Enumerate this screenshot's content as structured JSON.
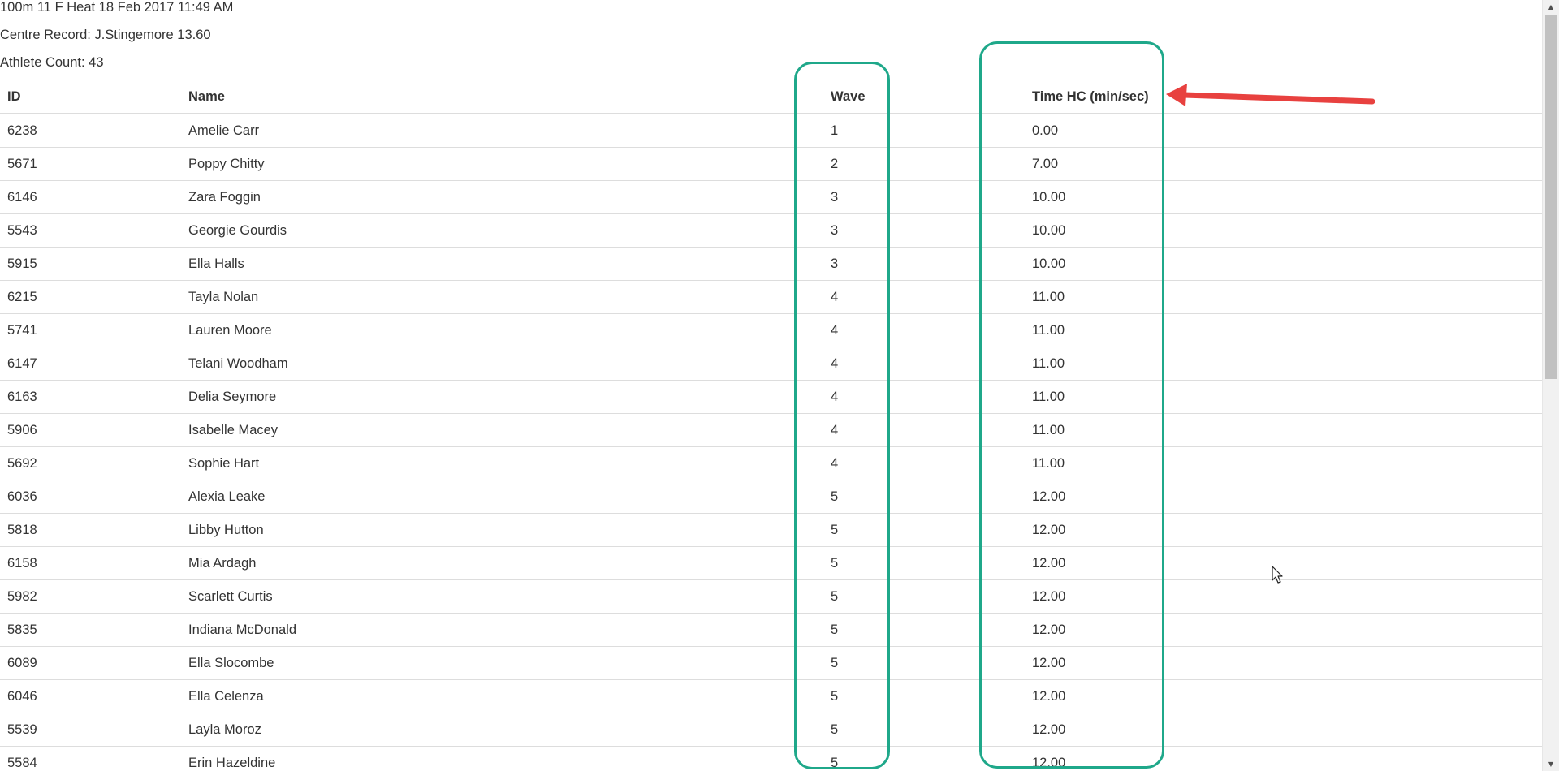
{
  "header": {
    "title": "100m 11 F Heat 18 Feb 2017 11:49 AM",
    "record": "Centre Record: J.Stingemore 13.60",
    "count": "Athlete Count: 43"
  },
  "table": {
    "columns": [
      "ID",
      "Name",
      "Wave",
      "Time HC (min/sec)"
    ],
    "rows": [
      {
        "id": "6238",
        "name": "Amelie Carr",
        "wave": "1",
        "time": "0.00"
      },
      {
        "id": "5671",
        "name": "Poppy Chitty",
        "wave": "2",
        "time": "7.00"
      },
      {
        "id": "6146",
        "name": "Zara Foggin",
        "wave": "3",
        "time": "10.00"
      },
      {
        "id": "5543",
        "name": "Georgie Gourdis",
        "wave": "3",
        "time": "10.00"
      },
      {
        "id": "5915",
        "name": "Ella Halls",
        "wave": "3",
        "time": "10.00"
      },
      {
        "id": "6215",
        "name": "Tayla Nolan",
        "wave": "4",
        "time": "11.00"
      },
      {
        "id": "5741",
        "name": "Lauren Moore",
        "wave": "4",
        "time": "11.00"
      },
      {
        "id": "6147",
        "name": "Telani Woodham",
        "wave": "4",
        "time": "11.00"
      },
      {
        "id": "6163",
        "name": "Delia Seymore",
        "wave": "4",
        "time": "11.00"
      },
      {
        "id": "5906",
        "name": "Isabelle Macey",
        "wave": "4",
        "time": "11.00"
      },
      {
        "id": "5692",
        "name": "Sophie Hart",
        "wave": "4",
        "time": "11.00"
      },
      {
        "id": "6036",
        "name": "Alexia Leake",
        "wave": "5",
        "time": "12.00"
      },
      {
        "id": "5818",
        "name": "Libby Hutton",
        "wave": "5",
        "time": "12.00"
      },
      {
        "id": "6158",
        "name": "Mia Ardagh",
        "wave": "5",
        "time": "12.00"
      },
      {
        "id": "5982",
        "name": "Scarlett Curtis",
        "wave": "5",
        "time": "12.00"
      },
      {
        "id": "5835",
        "name": "Indiana McDonald",
        "wave": "5",
        "time": "12.00"
      },
      {
        "id": "6089",
        "name": "Ella Slocombe",
        "wave": "5",
        "time": "12.00"
      },
      {
        "id": "6046",
        "name": "Ella Celenza",
        "wave": "5",
        "time": "12.00"
      },
      {
        "id": "5539",
        "name": "Layla Moroz",
        "wave": "5",
        "time": "12.00"
      },
      {
        "id": "5584",
        "name": "Erin Hazeldine",
        "wave": "5",
        "time": "12.00"
      }
    ]
  },
  "annotations": {
    "highlight_color": "#1fa88a",
    "arrow_color": "#e8413f"
  },
  "scrollbar": {
    "up_icon": "scroll-up-arrow-icon",
    "down_icon": "scroll-down-arrow-icon"
  }
}
